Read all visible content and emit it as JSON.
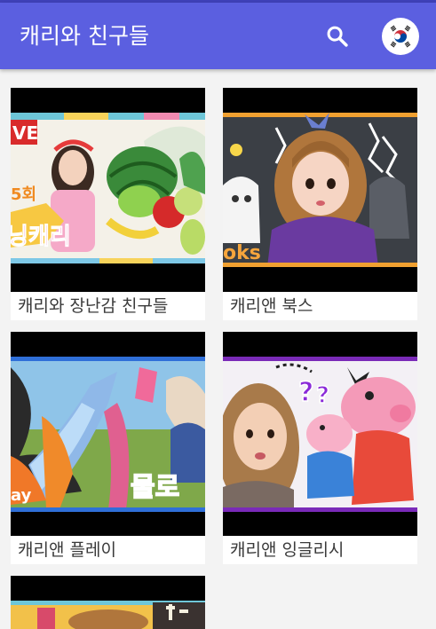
{
  "app": {
    "title": "캐리와 친구들"
  },
  "toolbar": {
    "search_icon": "search-icon",
    "language_icon": "korea-flag-icon"
  },
  "colors": {
    "appbar": "#5b5fe0",
    "background": "#f3f3f3",
    "card": "#ffffff",
    "label_text": "#3a3a3a"
  },
  "channels": [
    {
      "label": "캐리와 장난감 친구들",
      "thumb_texts": [
        "VE",
        "5회",
        "닝캐리"
      ]
    },
    {
      "label": "캐리앤 북스",
      "thumb_texts": [
        "oks"
      ]
    },
    {
      "label": "캐리앤 플레이",
      "thumb_texts": [
        "물로",
        "ay"
      ]
    },
    {
      "label": "캐리앤 잉글리시",
      "thumb_texts": [
        "?",
        "?"
      ]
    }
  ]
}
